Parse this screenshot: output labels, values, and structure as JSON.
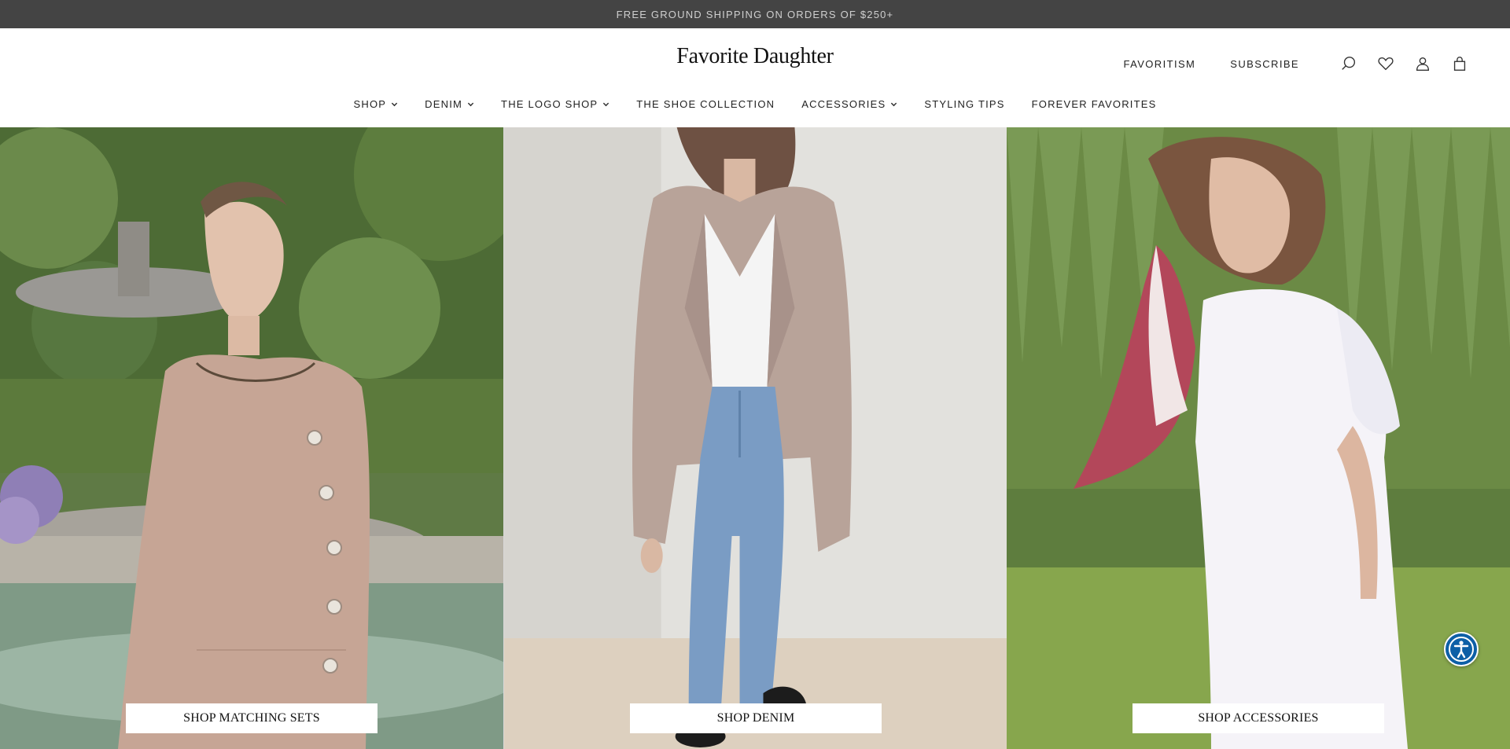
{
  "announcement": {
    "text": "FREE GROUND SHIPPING ON ORDERS OF $250+"
  },
  "header": {
    "logo": "Favorite Daughter",
    "utility_links": {
      "favoritism": "FAVORITISM",
      "subscribe": "SUBSCRIBE"
    },
    "icons": [
      "search-icon",
      "heart-icon",
      "account-icon",
      "bag-icon"
    ]
  },
  "nav": {
    "items": [
      {
        "label": "SHOP",
        "has_dropdown": true
      },
      {
        "label": "DENIM",
        "has_dropdown": true
      },
      {
        "label": "THE LOGO SHOP",
        "has_dropdown": true
      },
      {
        "label": "THE SHOE COLLECTION",
        "has_dropdown": false
      },
      {
        "label": "ACCESSORIES",
        "has_dropdown": true
      },
      {
        "label": "STYLING TIPS",
        "has_dropdown": false
      },
      {
        "label": "FOREVER FAVORITES",
        "has_dropdown": false
      }
    ]
  },
  "hero": {
    "panels": [
      {
        "cta": "SHOP MATCHING SETS"
      },
      {
        "cta": "SHOP DENIM"
      },
      {
        "cta": "SHOP ACCESSORIES"
      }
    ]
  },
  "colors": {
    "announcement_bg": "#444444",
    "accessibility_button": "#0d5fa6"
  }
}
